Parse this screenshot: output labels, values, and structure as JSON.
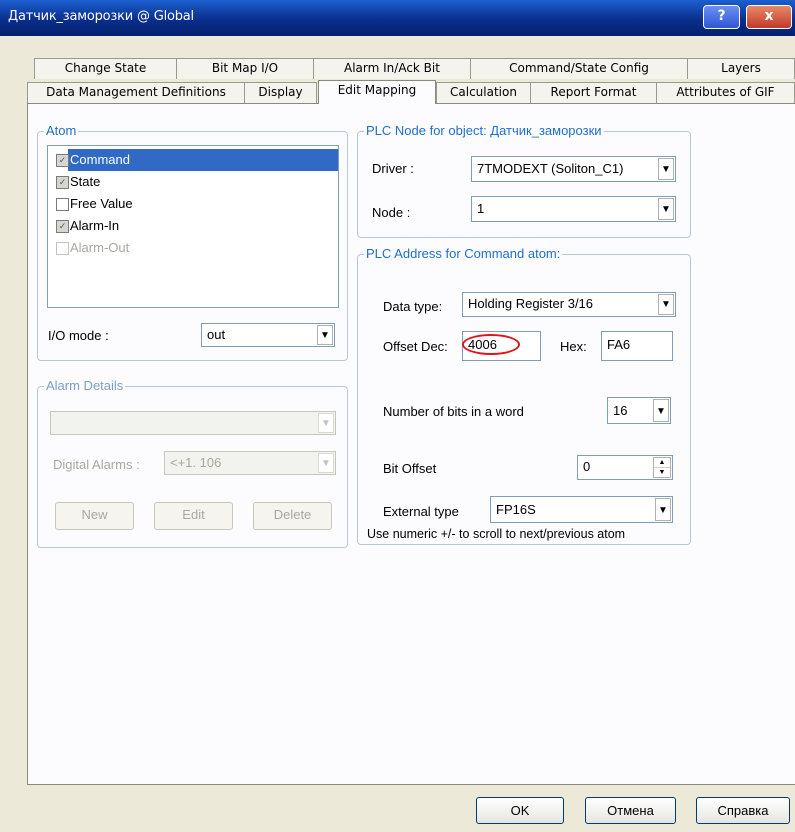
{
  "window": {
    "title": "Датчик_заморозки @ Global",
    "help_label": "?",
    "close_label": "x"
  },
  "tabs_row1": [
    "Change State",
    "Bit Map I/O",
    "Alarm In/Ack Bit",
    "Command/State Config",
    "Layers"
  ],
  "tabs_row2": [
    "Data Management Definitions",
    "Display",
    "Edit Mapping",
    "Calculation",
    "Report Format",
    "Attributes of GIF"
  ],
  "active_tab": "Edit Mapping",
  "atom": {
    "legend": "Atom",
    "items": [
      {
        "label": "Command",
        "checked": true,
        "selected": true,
        "enabled": true
      },
      {
        "label": "State",
        "checked": true,
        "selected": false,
        "enabled": true
      },
      {
        "label": "Free Value",
        "checked": false,
        "selected": false,
        "enabled": true
      },
      {
        "label": "Alarm-In",
        "checked": true,
        "selected": false,
        "enabled": true
      },
      {
        "label": "Alarm-Out",
        "checked": false,
        "selected": false,
        "enabled": false
      }
    ],
    "io_mode_label": "I/O mode :",
    "io_mode_value": "out"
  },
  "alarm_details": {
    "legend": "Alarm Details",
    "top_value": "",
    "digital_alarms_label": "Digital Alarms :",
    "digital_alarms_value": "<+1. 106",
    "new_label": "New",
    "edit_label": "Edit",
    "delete_label": "Delete"
  },
  "plc_node": {
    "legend": "PLC Node for object: Датчик_заморозки",
    "driver_label": "Driver :",
    "driver_value": "7TMODEXT (Soliton_C1)",
    "node_label": "Node :",
    "node_value": "1"
  },
  "plc_address": {
    "legend": "PLC Address for Command atom:",
    "data_type_label": "Data type:",
    "data_type_value": "Holding Register 3/16",
    "offset_dec_label": "Offset Dec:",
    "offset_dec_value": "4006",
    "hex_label": "Hex:",
    "hex_value": "FA6",
    "bits_label": "Number of bits in a word",
    "bits_value": "16",
    "bit_offset_label": "Bit Offset",
    "bit_offset_value": "0",
    "external_type_label": "External type",
    "external_type_value": "FP16S",
    "hint": "Use numeric +/- to scroll to next/previous atom"
  },
  "buttons": {
    "ok": "OK",
    "cancel": "Отмена",
    "help": "Справка"
  },
  "colors": {
    "legend_blue": "#1f6fc9",
    "title_bar": "#0a2e8c",
    "selection": "#316ac5",
    "annotation_red": "#e0141c"
  }
}
